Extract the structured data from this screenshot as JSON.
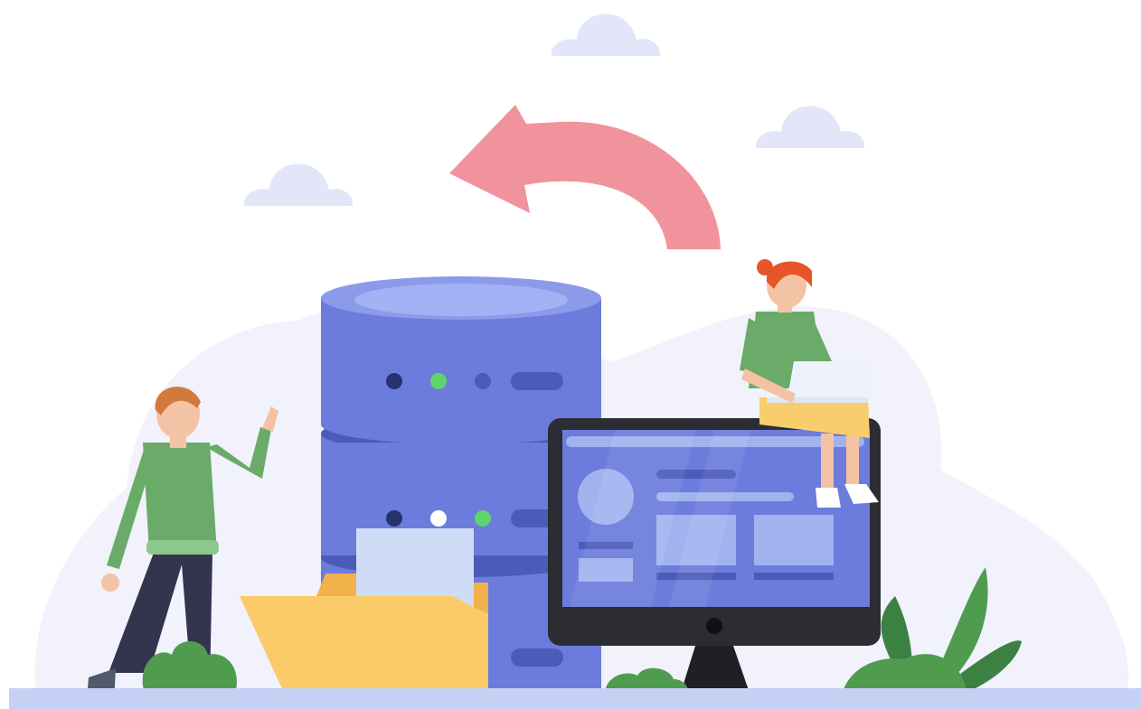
{
  "illustration": {
    "subject": "data-backup-restore",
    "icons": [
      "cloud-icon",
      "restore-arrow-icon",
      "database-icon",
      "folder-icon",
      "document-icon",
      "monitor-icon",
      "laptop-icon",
      "plant-icon"
    ]
  },
  "colors": {
    "background": "#ffffff",
    "backdrop_blob": "#f1f2fb",
    "cloud": "#e3e6f8",
    "arrow": "#f1939c",
    "database_body": "#6b7cdc",
    "database_top": "#a3b2f4",
    "database_band": "#4b5cb8",
    "led_green": "#5fd46a",
    "led_dark": "#27326e",
    "led_white": "#ffffff",
    "folder": "#fbcb6a",
    "folder_back": "#f1b24b",
    "paper": "#cfdcf5",
    "monitor_frame": "#2c2c33",
    "monitor_screen": "#6b7cdc",
    "screen_element": "#a2b2ef",
    "sweater_green": "#6aab69",
    "pants": "#35344f",
    "skin": "#f4c3a5",
    "hair_man": "#d17a3b",
    "hair_woman": "#e65528",
    "skirt": "#f8cd6b",
    "plant": "#4f9c4f",
    "plant_dark": "#3c8142",
    "floor": "#c6cff4"
  }
}
